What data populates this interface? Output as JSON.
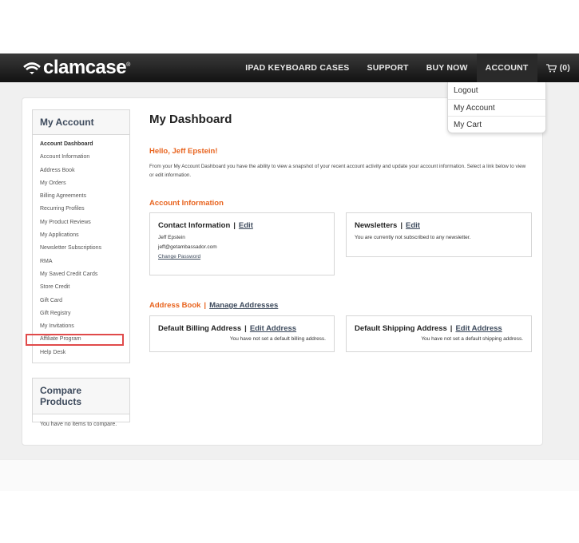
{
  "header": {
    "logo_text": "clamcase",
    "logo_mark": "®",
    "nav": [
      {
        "label": "IPAD KEYBOARD CASES"
      },
      {
        "label": "SUPPORT"
      },
      {
        "label": "BUY NOW"
      },
      {
        "label": "ACCOUNT"
      }
    ],
    "cart_count": "(0)"
  },
  "account_dropdown": {
    "items": [
      {
        "label": "Logout"
      },
      {
        "label": "My Account"
      },
      {
        "label": "My Cart"
      }
    ]
  },
  "sidebar": {
    "title": "My Account",
    "items": [
      {
        "label": "Account Dashboard"
      },
      {
        "label": "Account Information"
      },
      {
        "label": "Address Book"
      },
      {
        "label": "My Orders"
      },
      {
        "label": "Billing Agreements"
      },
      {
        "label": "Recurring Profiles"
      },
      {
        "label": "My Product Reviews"
      },
      {
        "label": "My Applications"
      },
      {
        "label": "Newsletter Subscriptions"
      },
      {
        "label": "RMA"
      },
      {
        "label": "My Saved Credit Cards"
      },
      {
        "label": "Store Credit"
      },
      {
        "label": "Gift Card"
      },
      {
        "label": "Gift Registry"
      },
      {
        "label": "My Invitations"
      },
      {
        "label": "Affiliate Program"
      },
      {
        "label": "Help Desk"
      }
    ]
  },
  "compare": {
    "title": "Compare Products",
    "empty_text": "You have no items to compare."
  },
  "dashboard": {
    "title": "My Dashboard",
    "hello": "Hello, Jeff Epstein!",
    "intro": "From your My Account Dashboard you have the ability to view a snapshot of your recent account activity and update your account information. Select a link below to view or edit information."
  },
  "account_info": {
    "title": "Account Information",
    "contact": {
      "title": "Contact Information",
      "edit": "Edit",
      "name": "Jeff Epstein",
      "email": "jeff@getambassador.com",
      "change_password": "Change Password"
    },
    "newsletters": {
      "title": "Newsletters",
      "edit": "Edit",
      "text": "You are currently not subscribed to any newsletter."
    }
  },
  "address_book": {
    "title": "Address Book",
    "manage": "Manage Addresses",
    "billing": {
      "title": "Default Billing Address",
      "edit": "Edit Address",
      "text": "You have not set a default billing address."
    },
    "shipping": {
      "title": "Default Shipping Address",
      "edit": "Edit Address",
      "text": "You have not set a default shipping address."
    }
  }
}
